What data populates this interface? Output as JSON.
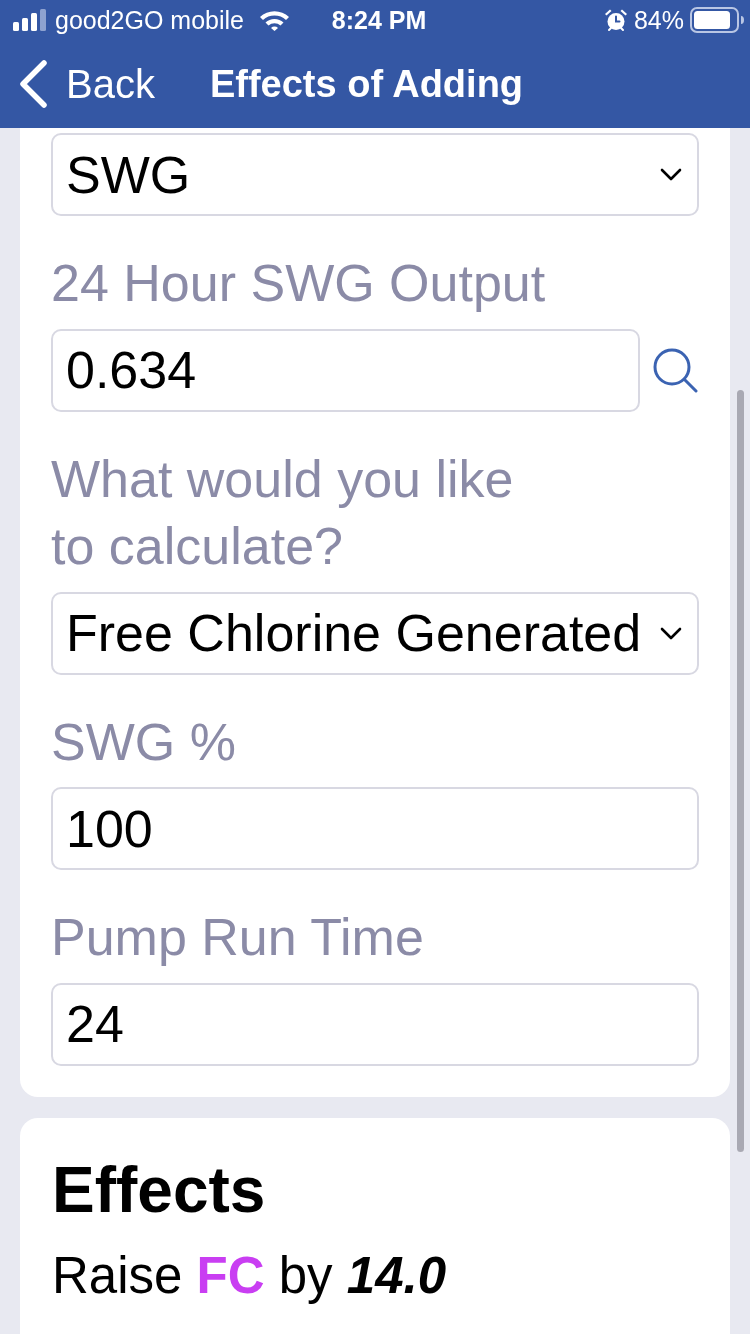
{
  "status_bar": {
    "carrier": "good2GO mobile",
    "time": "8:24 PM",
    "battery": "84%"
  },
  "nav_bar": {
    "back": "Back",
    "title": "Effects of Adding"
  },
  "form": {
    "fields": [
      {
        "kind": "select",
        "value": "SWG"
      },
      {
        "kind": "input",
        "label": "24 Hour SWG Output",
        "value": "0.634",
        "lookup": true
      },
      {
        "kind": "select",
        "label": "What would you like to calculate?",
        "value": "Free Chlorine Generated"
      },
      {
        "kind": "input",
        "label": "SWG %",
        "value": "100",
        "lookup": false
      },
      {
        "kind": "input",
        "label": "Pump Run Time",
        "value": "24",
        "lookup": false
      }
    ]
  },
  "effects": {
    "title": "Effects",
    "items": [
      {
        "action": "Raise",
        "chemical": "FC",
        "color": "#c93ef2",
        "connector": "by",
        "amount": "14.0"
      }
    ]
  }
}
